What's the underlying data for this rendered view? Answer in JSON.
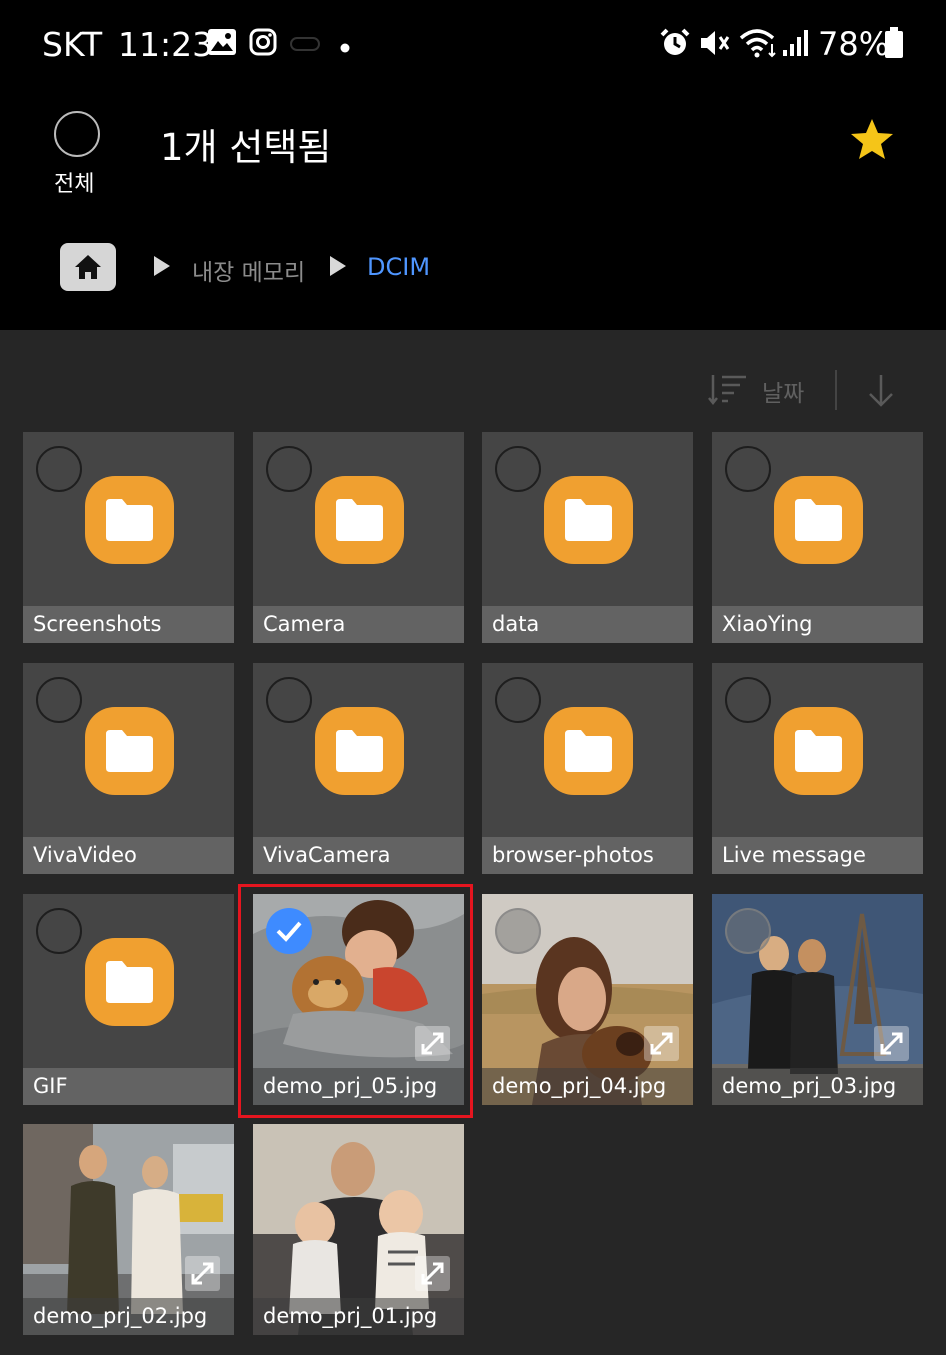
{
  "status_bar": {
    "carrier": "SKT",
    "time": "11:23",
    "battery": "78%",
    "icons": [
      "gallery-icon",
      "instagram-icon",
      "more-notifications-icon",
      "alarm-icon",
      "mute-icon",
      "wifi-icon",
      "signal-icon",
      "battery-icon"
    ]
  },
  "header": {
    "select_all_label": "전체",
    "selected_count_text": "1개 선택됨",
    "favorite_icon": "star-icon",
    "favorite_color": "#f5c518"
  },
  "breadcrumb": {
    "home_icon": "home-icon",
    "items": [
      "내장 메모리",
      "DCIM"
    ],
    "current_color": "#4f96ff"
  },
  "sort": {
    "label": "날짜",
    "icon": "sort-icon",
    "direction_icon": "arrow-down-icon"
  },
  "items": [
    {
      "name": "Screenshots",
      "type": "folder",
      "selected": false
    },
    {
      "name": "Camera",
      "type": "folder",
      "selected": false
    },
    {
      "name": "data",
      "type": "folder",
      "selected": false
    },
    {
      "name": "XiaoYing",
      "type": "folder",
      "selected": false
    },
    {
      "name": "VivaVideo",
      "type": "folder",
      "selected": false
    },
    {
      "name": "VivaCamera",
      "type": "folder",
      "selected": false
    },
    {
      "name": "browser-photos",
      "type": "folder",
      "selected": false
    },
    {
      "name": "Live message",
      "type": "folder",
      "selected": false
    },
    {
      "name": "GIF",
      "type": "folder",
      "selected": false
    },
    {
      "name": "demo_prj_05.jpg",
      "type": "image",
      "selected": true
    },
    {
      "name": "demo_prj_04.jpg",
      "type": "image",
      "selected": false
    },
    {
      "name": "demo_prj_03.jpg",
      "type": "image",
      "selected": false
    },
    {
      "name": "demo_prj_02.jpg",
      "type": "image",
      "selected": false
    },
    {
      "name": "demo_prj_01.jpg",
      "type": "image",
      "selected": false
    }
  ],
  "colors": {
    "folder": "#f0a030",
    "selection_check": "#3e8bff",
    "highlight_frame": "#e5151f"
  }
}
